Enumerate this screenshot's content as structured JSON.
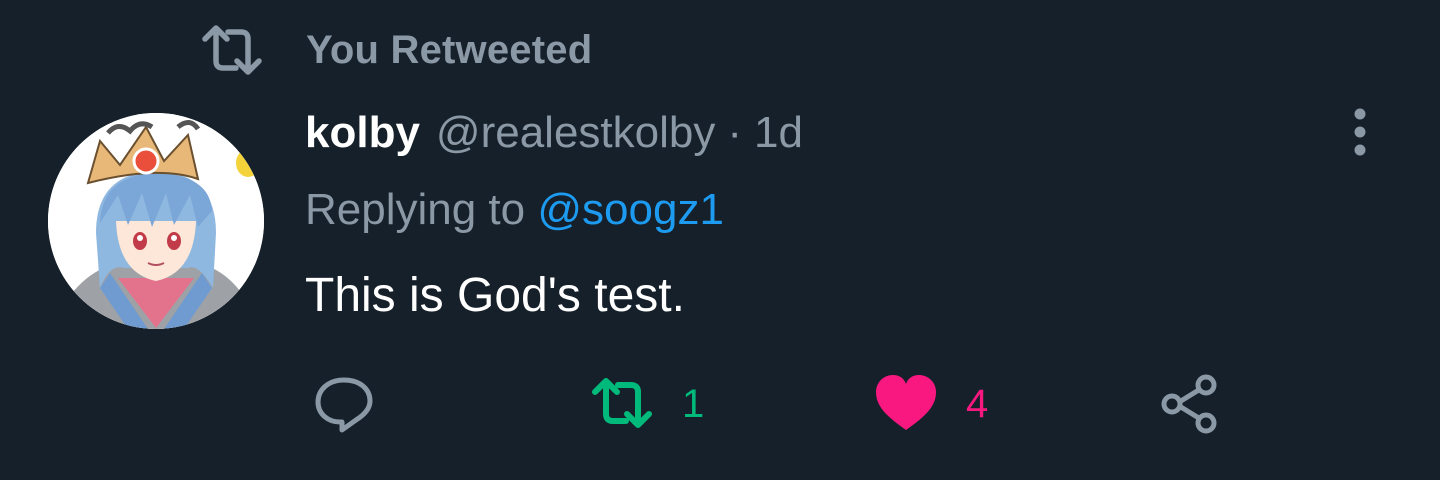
{
  "retweet_banner": {
    "label": "You Retweeted",
    "icon": "retweet-icon"
  },
  "tweet": {
    "author": {
      "display_name": "kolby",
      "handle": "@realestkolby",
      "avatar": "anime-avatar"
    },
    "separator": "·",
    "timestamp": "1d",
    "reply": {
      "prefix": "Replying to ",
      "mention": "@soogz1"
    },
    "text": "This is God's test.",
    "more_icon": "more-vertical-icon"
  },
  "actions": {
    "reply": {
      "icon": "reply-icon"
    },
    "retweet": {
      "icon": "retweet-icon",
      "count": "1",
      "active": true
    },
    "like": {
      "icon": "heart-icon",
      "count": "4",
      "active": true
    },
    "share": {
      "icon": "share-icon"
    }
  },
  "colors": {
    "background": "#16202a",
    "muted_text": "#8b98a5",
    "link": "#1d9bf0",
    "retweet_active": "#00ba7c",
    "like_active": "#f91880"
  }
}
